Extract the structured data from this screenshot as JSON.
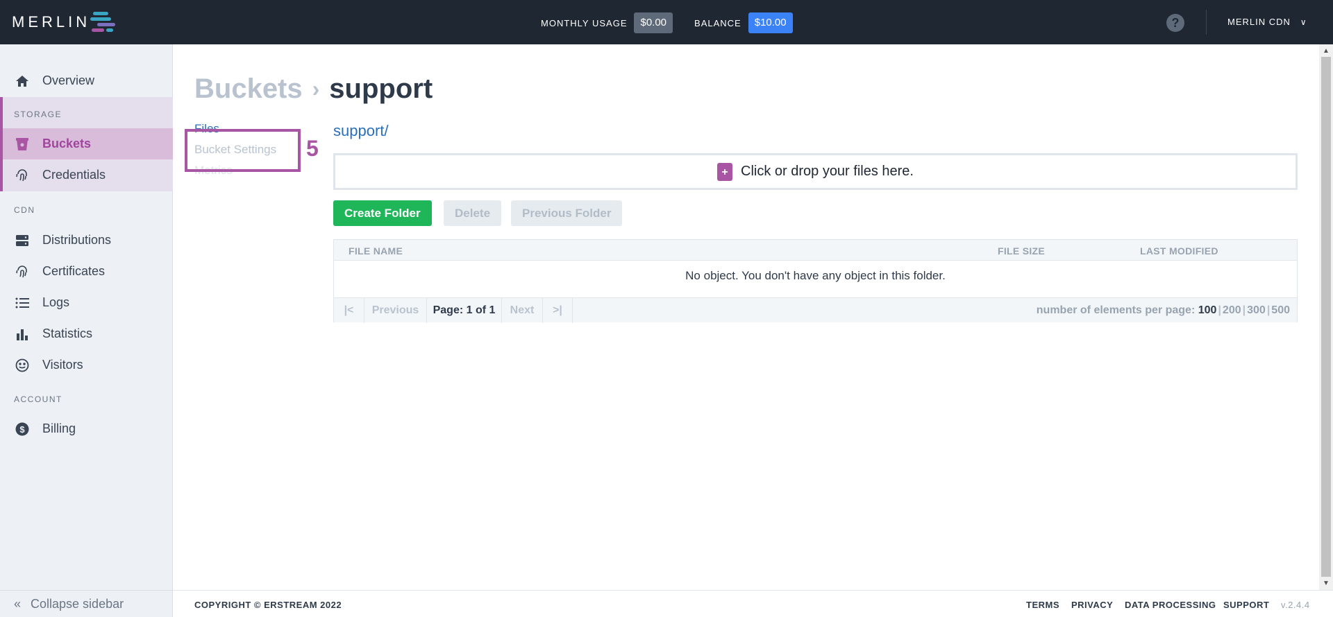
{
  "header": {
    "logo_text": "MERLIN",
    "monthly_usage_label": "MONTHLY USAGE",
    "monthly_usage_value": "$0.00",
    "balance_label": "BALANCE",
    "balance_value": "$10.00",
    "help_icon": "?",
    "account_name": "MERLIN CDN"
  },
  "sidebar": {
    "overview": "Overview",
    "storage_section": "STORAGE",
    "buckets": "Buckets",
    "credentials": "Credentials",
    "cdn_section": "CDN",
    "distributions": "Distributions",
    "certificates": "Certificates",
    "logs": "Logs",
    "statistics": "Statistics",
    "visitors": "Visitors",
    "account_section": "ACCOUNT",
    "billing": "Billing",
    "collapse": "Collapse sidebar"
  },
  "breadcrumb": {
    "parent": "Buckets",
    "separator": "›",
    "current": "support"
  },
  "subnav": {
    "files": "Files",
    "bucket_settings": "Bucket Settings",
    "metrics": "Metrics"
  },
  "annotation": {
    "step": "5"
  },
  "browser": {
    "path": "support/",
    "drop_text": "Click or drop your files here.",
    "create_folder": "Create Folder",
    "delete": "Delete",
    "previous_folder": "Previous Folder"
  },
  "table": {
    "col_name": "FILE NAME",
    "col_size": "FILE SIZE",
    "col_modified": "LAST MODIFIED",
    "empty_message": "No object. You don't have any object in this folder."
  },
  "pager": {
    "first": "|<",
    "previous": "Previous",
    "page_info": "Page: 1 of 1",
    "next": "Next",
    "last": ">|",
    "per_page_label": "number of elements per page:",
    "options": [
      "100",
      "200",
      "300",
      "500"
    ],
    "selected": "100"
  },
  "footer": {
    "copyright": "COPYRIGHT © ERSTREAM 2022",
    "terms": "TERMS",
    "privacy": "PRIVACY",
    "data_processing": "DATA PROCESSING",
    "support": "SUPPORT",
    "version": "v.2.4.4"
  },
  "colors": {
    "accent": "#a855a4",
    "topbar": "#1f2733",
    "primary_green": "#1fb65a",
    "balance_blue": "#3b82f6"
  }
}
